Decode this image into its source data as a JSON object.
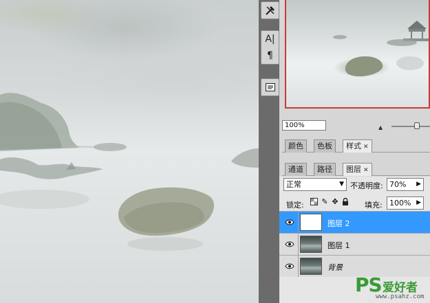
{
  "toolstrip": {
    "icons": [
      "tools-icon",
      "character-icon",
      "paragraph-icon",
      "info-panel-icon"
    ],
    "character_glyph": "A|",
    "paragraph_glyph": "¶"
  },
  "navigator": {
    "zoom": "100%"
  },
  "styles_panel": {
    "tabs": [
      {
        "label": "颜色",
        "active": false
      },
      {
        "label": "色板",
        "active": false
      },
      {
        "label": "样式",
        "active": true
      }
    ]
  },
  "layers_panel": {
    "tabs": [
      {
        "label": "通道",
        "active": false
      },
      {
        "label": "路径",
        "active": false
      },
      {
        "label": "图层",
        "active": true
      }
    ],
    "blend_mode": "正常",
    "opacity_label": "不透明度:",
    "opacity": "70%",
    "lock_label": "锁定:",
    "fill_label": "填充:",
    "fill": "100%",
    "layers": [
      {
        "name": "图层 2",
        "visible": true,
        "selected": true,
        "thumb": "white"
      },
      {
        "name": "图层 1",
        "visible": true,
        "selected": false,
        "thumb": "landscape"
      },
      {
        "name": "背景",
        "visible": true,
        "selected": false,
        "thumb": "landscape"
      }
    ]
  },
  "watermark": {
    "logo": "PS",
    "chinese": "爱好者",
    "url": "www.psahz.com"
  },
  "colors": {
    "selection": "#3399ff",
    "navigator_frame": "#cc3838",
    "watermark": "#3a9b35"
  }
}
